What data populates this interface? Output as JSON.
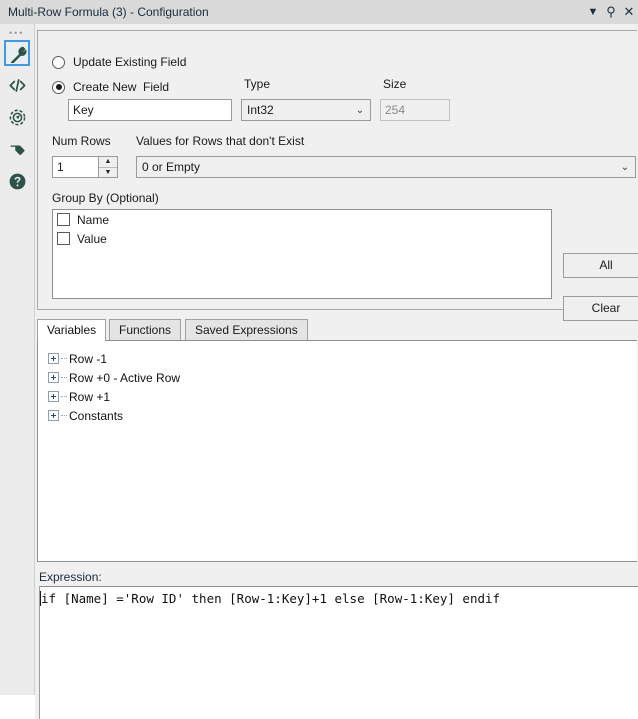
{
  "window": {
    "title": "Multi-Row Formula (3) - Configuration",
    "dropdown_glyph": "▼",
    "pin_glyph": "⚲",
    "close_glyph": "✕"
  },
  "rail": {
    "handle_glyph": "•••",
    "items": [
      {
        "name": "wrench-icon",
        "selected": true
      },
      {
        "name": "code-icon",
        "selected": false
      },
      {
        "name": "target-icon",
        "selected": false
      },
      {
        "name": "tag-icon",
        "selected": false
      },
      {
        "name": "help-icon",
        "selected": false
      }
    ]
  },
  "field_mode": {
    "update_existing_label": "Update Existing Field",
    "create_new_label": "Create New  Field",
    "selected": "create_new"
  },
  "field": {
    "name_label": "",
    "name_value": "Key",
    "type_label": "Type",
    "type_value": "Int32",
    "size_label": "Size",
    "size_value": "254",
    "arrow_glyph": "⌄"
  },
  "rows": {
    "num_rows_label": "Num Rows",
    "num_rows_value": "1",
    "spin_up_glyph": "▲",
    "spin_down_glyph": "▼",
    "defaults_label": "Values for Rows that don't Exist",
    "defaults_value": "0 or Empty",
    "arrow_glyph": "⌄"
  },
  "group_by": {
    "label": "Group By (Optional)",
    "items": [
      {
        "label": "Name",
        "checked": false
      },
      {
        "label": "Value",
        "checked": false
      }
    ],
    "all_button": "All",
    "clear_button": "Clear"
  },
  "tabs": [
    {
      "label": "Variables",
      "active": true
    },
    {
      "label": "Functions",
      "active": false
    },
    {
      "label": "Saved Expressions",
      "active": false
    }
  ],
  "tree": [
    {
      "label": "Row -1"
    },
    {
      "label": "Row +0 - Active Row"
    },
    {
      "label": "Row +1"
    },
    {
      "label": "Constants"
    }
  ],
  "expression": {
    "label": "Expression:",
    "value": "if [Name] ='Row ID' then [Row-1:Key]+1 else [Row-1:Key] endif"
  },
  "colors": {
    "titlebar_bg": "#d9d9d9",
    "panel_bg": "#f0f0f0",
    "rail_bg": "#ececed",
    "icon": "#2d5249",
    "selection_accent": "#3f9ae0"
  }
}
